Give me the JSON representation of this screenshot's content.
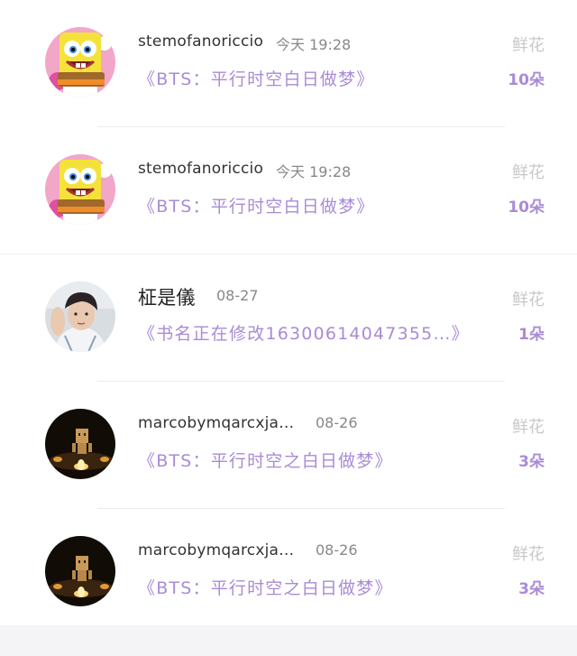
{
  "gifts": [
    {
      "user": "stemofanoriccio",
      "time": "今天 19:28",
      "book": "《BTS：平行时空白日做梦》",
      "flower_label": "鲜花",
      "flower_count": "10朵",
      "avatar_icon": "spongebob-avatar"
    },
    {
      "user": "stemofanoriccio",
      "time": "今天 19:28",
      "book": "《BTS：平行时空白日做梦》",
      "flower_label": "鲜花",
      "flower_count": "10朵",
      "avatar_icon": "spongebob-avatar"
    },
    {
      "user": "柾是儀",
      "time": "08-27",
      "book": "《书名正在修改16300614047355…》",
      "flower_label": "鲜花",
      "flower_count": "1朵",
      "avatar_icon": "person-avatar"
    },
    {
      "user": "marcobymqarcxja…",
      "time": "08-26",
      "book": "《BTS：平行时空之白日做梦》",
      "flower_label": "鲜花",
      "flower_count": "3朵",
      "avatar_icon": "candle-figure-avatar"
    },
    {
      "user": "marcobymqarcxja…",
      "time": "08-26",
      "book": "《BTS：平行时空之白日做梦》",
      "flower_label": "鲜花",
      "flower_count": "3朵",
      "avatar_icon": "candle-figure-avatar"
    }
  ],
  "colors": {
    "accent": "#a98bd6",
    "muted": "#c8c8c8",
    "name": "#333333",
    "time": "#888888"
  }
}
